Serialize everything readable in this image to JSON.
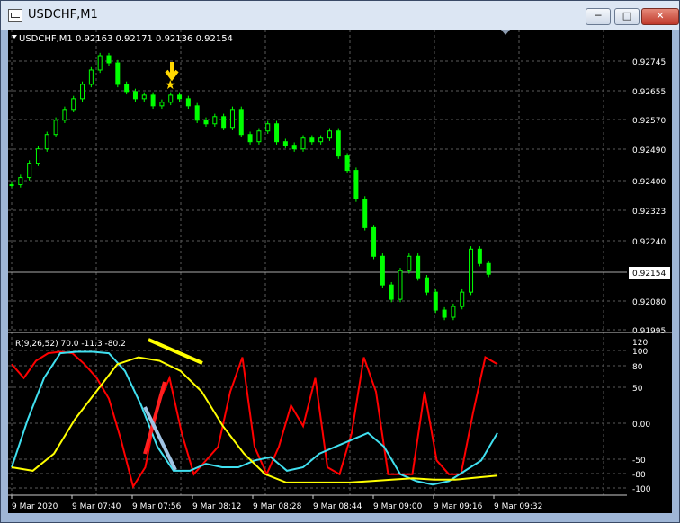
{
  "window": {
    "title": "USDCHF,M1",
    "min_icon": "minimize-icon",
    "max_icon": "maximize-icon",
    "close_icon": "close-icon"
  },
  "price_panel": {
    "header": "USDCHF,M1  0.92163 0.92171 0.92136 0.92154",
    "current_price": "0.92154",
    "price_labels": [
      "0.92745",
      "0.92655",
      "0.92570",
      "0.92490",
      "0.92400",
      "0.92323",
      "0.92240",
      "0.92080",
      "0.91995"
    ]
  },
  "indicator_panel": {
    "header": "R(9,26,52) 70.0 -11.3 -80.2",
    "level_labels": [
      "120",
      "100",
      "80",
      "50",
      "0.00",
      "-50",
      "-80",
      "-100"
    ]
  },
  "time_axis": {
    "labels": [
      "9 Mar 2020",
      "9 Mar 07:40",
      "9 Mar 07:56",
      "9 Mar 08:12",
      "9 Mar 08:28",
      "9 Mar 08:44",
      "9 Mar 09:00",
      "9 Mar 09:16",
      "9 Mar 09:32"
    ]
  },
  "colors": {
    "candle": "#00ff00",
    "red_line": "#ff0000",
    "cyan_line": "#40e0f0",
    "yellow_line": "#ffff00",
    "annotation_arrow": "#ffd700"
  },
  "chart_data": [
    {
      "type": "candlestick",
      "symbol": "USDCHF",
      "timeframe": "M1",
      "close_approx": [
        0.924,
        0.9242,
        0.9246,
        0.925,
        0.9254,
        0.9258,
        0.9261,
        0.9264,
        0.9268,
        0.9272,
        0.9276,
        0.9274,
        0.9268,
        0.9266,
        0.9264,
        0.9265,
        0.9262,
        0.9263,
        0.9265,
        0.9264,
        0.9262,
        0.9258,
        0.9257,
        0.9259,
        0.9256,
        0.9261,
        0.9254,
        0.9252,
        0.9255,
        0.9257,
        0.9252,
        0.9251,
        0.925,
        0.9253,
        0.9252,
        0.9253,
        0.9255,
        0.9248,
        0.9244,
        0.9236,
        0.9228,
        0.922,
        0.9212,
        0.9208,
        0.9216,
        0.922,
        0.9214,
        0.921,
        0.9205,
        0.9203,
        0.9206,
        0.921,
        0.9222,
        0.9218,
        0.9215
      ],
      "ylim": [
        0.91995,
        0.92745
      ]
    },
    {
      "type": "line",
      "series": [
        {
          "name": "red",
          "values": [
            80,
            60,
            85,
            96,
            98,
            96,
            80,
            60,
            30,
            -30,
            -98,
            -70,
            20,
            60,
            -20,
            -80,
            -60,
            -40,
            40,
            90,
            -40,
            -80,
            -40,
            20,
            -10,
            60,
            -70,
            -80,
            -20,
            90,
            40,
            -80,
            -80,
            -80,
            40,
            -60,
            -80,
            -80,
            10,
            90,
            80
          ]
        },
        {
          "name": "cyan",
          "values": [
            -70,
            0,
            60,
            96,
            98,
            98,
            96,
            70,
            20,
            -40,
            -75,
            -75,
            -65,
            -70,
            -70,
            -60,
            -55,
            -75,
            -70,
            -50,
            -40,
            -30,
            -20,
            -40,
            -80,
            -90,
            -95,
            -90,
            -75,
            -60,
            -20
          ]
        },
        {
          "name": "yellow",
          "values": [
            -70,
            -75,
            -50,
            0,
            40,
            80,
            90,
            85,
            70,
            40,
            -10,
            -50,
            -80,
            -92,
            -92,
            -92,
            -92,
            -90,
            -88,
            -86,
            -88,
            -88,
            -85,
            -82
          ]
        }
      ],
      "ylim": [
        -100,
        120
      ]
    }
  ]
}
